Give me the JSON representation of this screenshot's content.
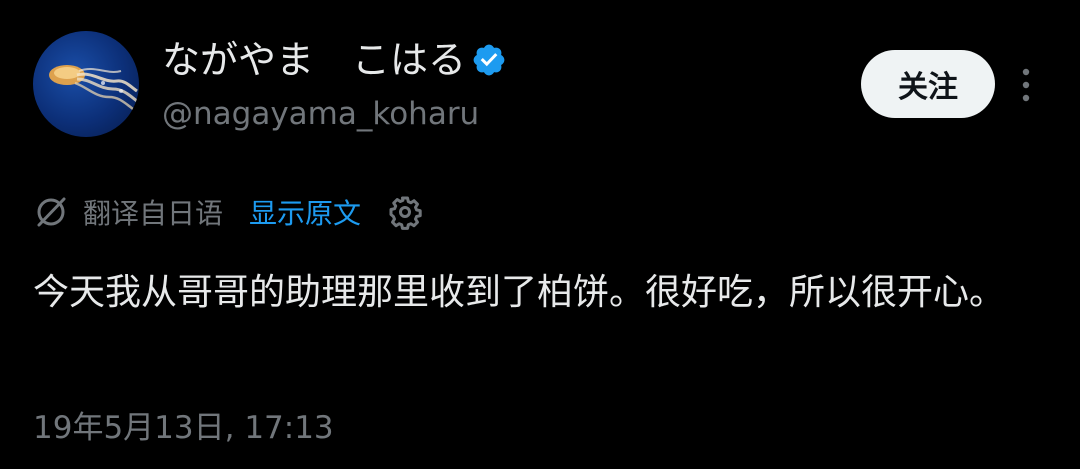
{
  "author": {
    "display_name": "ながやま　こはる",
    "handle": "@nagayama_koharu",
    "verified": true,
    "avatar_icon": "jellyfish-avatar"
  },
  "actions": {
    "follow_label": "关注",
    "more_icon": "more-vertical-icon"
  },
  "translation": {
    "label": "翻译自日语",
    "show_original_label": "显示原文",
    "translate_icon": "globe-slash-icon",
    "settings_icon": "gear-icon"
  },
  "tweet": {
    "text": "今天我从哥哥的助理那里收到了柏饼。很好吃，所以很开心。",
    "timestamp": "19年5月13日, 17:13"
  },
  "colors": {
    "background": "#000000",
    "text_primary": "#e7e9ea",
    "text_secondary": "#71767b",
    "link": "#1d9bf0",
    "verified": "#1d9bf0",
    "button_bg": "#eff3f4"
  }
}
